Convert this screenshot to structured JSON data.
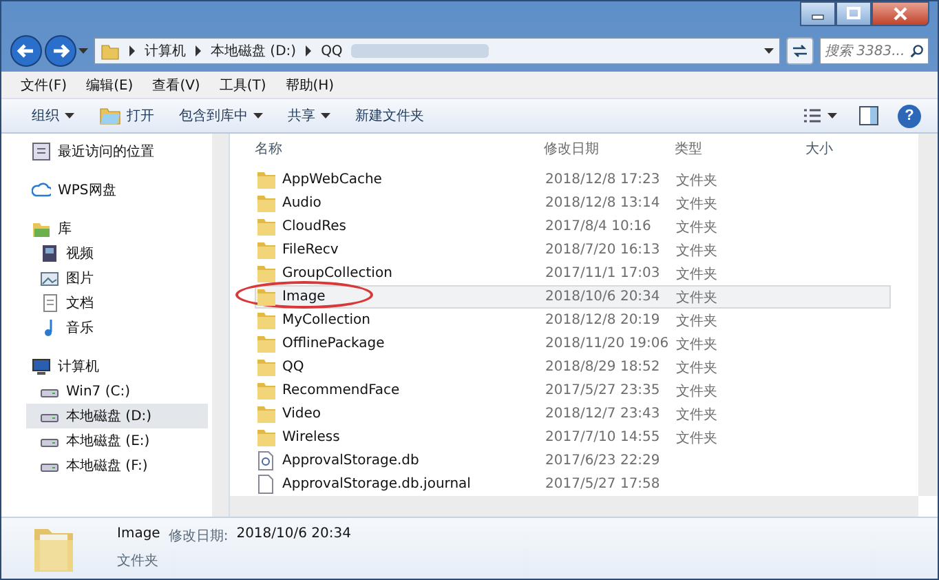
{
  "help": {
    "glyph": "?"
  },
  "address": {
    "crumbs": [
      "计算机",
      "本地磁盘 (D:)",
      "QQ"
    ],
    "search_placeholder": "搜索 3383..."
  },
  "menu": [
    "文件(F)",
    "编辑(E)",
    "查看(V)",
    "工具(T)",
    "帮助(H)"
  ],
  "toolbar": [
    {
      "label": "组织",
      "icon": false,
      "has_menu": true
    },
    {
      "label": "打开",
      "icon": true,
      "has_menu": false
    },
    {
      "label": "包含到库中",
      "icon": false,
      "has_menu": true
    },
    {
      "label": "共享",
      "icon": false,
      "has_menu": true
    },
    {
      "label": "新建文件夹",
      "icon": false,
      "has_menu": false
    }
  ],
  "sidebar": {
    "groups": [
      [
        {
          "label": "最近访问的位置",
          "kind": "recent",
          "selected": false
        }
      ],
      [
        {
          "label": "WPS网盘",
          "kind": "cloud",
          "selected": false
        }
      ],
      [
        {
          "label": "库",
          "kind": "library",
          "selected": false,
          "children": [
            {
              "label": "视频",
              "kind": "video",
              "selected": false
            },
            {
              "label": "图片",
              "kind": "picture",
              "selected": false
            },
            {
              "label": "文档",
              "kind": "document",
              "selected": false
            },
            {
              "label": "音乐",
              "kind": "music",
              "selected": false
            }
          ]
        }
      ],
      [
        {
          "label": "计算机",
          "kind": "computer",
          "selected": false,
          "children": [
            {
              "label": "Win7 (C:)",
              "kind": "drive",
              "selected": false
            },
            {
              "label": "本地磁盘 (D:)",
              "kind": "drive",
              "selected": true
            },
            {
              "label": "本地磁盘 (E:)",
              "kind": "drive",
              "selected": false
            },
            {
              "label": "本地磁盘 (F:)",
              "kind": "drive",
              "selected": false
            }
          ]
        }
      ]
    ]
  },
  "table": {
    "columns": [
      "名称",
      "修改日期",
      "类型",
      "大小"
    ],
    "rows": [
      {
        "name": "AppWebCache",
        "modified": "2018/12/8 17:23",
        "type": "文件夹",
        "kind": "folder",
        "selected": false,
        "circled": false
      },
      {
        "name": "Audio",
        "modified": "2018/12/8 13:14",
        "type": "文件夹",
        "kind": "folder",
        "selected": false,
        "circled": false
      },
      {
        "name": "CloudRes",
        "modified": "2017/8/4 10:16",
        "type": "文件夹",
        "kind": "folder",
        "selected": false,
        "circled": false
      },
      {
        "name": "FileRecv",
        "modified": "2018/7/20 16:13",
        "type": "文件夹",
        "kind": "folder",
        "selected": false,
        "circled": false
      },
      {
        "name": "GroupCollection",
        "modified": "2017/11/1 17:03",
        "type": "文件夹",
        "kind": "folder",
        "selected": false,
        "circled": false
      },
      {
        "name": "Image",
        "modified": "2018/10/6 20:34",
        "type": "文件夹",
        "kind": "folder",
        "selected": true,
        "circled": true
      },
      {
        "name": "MyCollection",
        "modified": "2018/12/8 20:19",
        "type": "文件夹",
        "kind": "folder",
        "selected": false,
        "circled": false
      },
      {
        "name": "OfflinePackage",
        "modified": "2018/11/20 19:06",
        "type": "文件夹",
        "kind": "folder",
        "selected": false,
        "circled": false
      },
      {
        "name": "QQ",
        "modified": "2018/8/29 18:52",
        "type": "文件夹",
        "kind": "folder",
        "selected": false,
        "circled": false
      },
      {
        "name": "RecommendFace",
        "modified": "2017/5/27 23:35",
        "type": "文件夹",
        "kind": "folder",
        "selected": false,
        "circled": false
      },
      {
        "name": "Video",
        "modified": "2018/12/7 23:43",
        "type": "文件夹",
        "kind": "folder",
        "selected": false,
        "circled": false
      },
      {
        "name": "Wireless",
        "modified": "2017/7/10 14:55",
        "type": "文件夹",
        "kind": "folder",
        "selected": false,
        "circled": false
      },
      {
        "name": "ApprovalStorage.db",
        "modified": "2017/6/23 22:29",
        "kind": "dbfile",
        "selected": false,
        "circled": false
      },
      {
        "name": "ApprovalStorage.db.journal",
        "modified": "2017/5/27 17:58",
        "kind": "file",
        "selected": false,
        "circled": false
      }
    ]
  },
  "details": {
    "name": "Image",
    "modified_label": "修改日期:",
    "modified": "2018/10/6 20:34",
    "type": "文件夹"
  }
}
